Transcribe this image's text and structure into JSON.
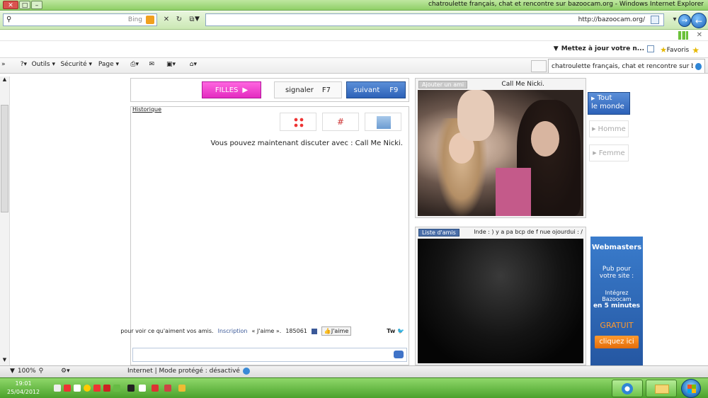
{
  "window": {
    "title": "chatroulette français, chat et rencontre sur bazoocam.org - Windows Internet Explorer",
    "close_label": "✕",
    "max_label": "□",
    "min_label": "–"
  },
  "address_bar": {
    "url": "http://bazoocam.org/",
    "search_placeholder": "Bing"
  },
  "favorites_bar": {
    "favoris_label": "Favoris",
    "update_label": "Mettez à jour votre n..."
  },
  "tab": {
    "label": "chatroulette français, chat et rencontre sur bazoo..."
  },
  "command_bar": {
    "page_label": "Page",
    "securite_label": "Sécurité",
    "outils_label": "Outils"
  },
  "chat": {
    "suivant_label": "suivant",
    "suivant_key": "F9",
    "signaler_label": "signaler",
    "signaler_key": "F7",
    "filles_label": "FILLES",
    "historique_label": "Historique",
    "message": "Vous pouvez maintenant discuter avec : Call Me Nicki.",
    "tweet_label": "Tw",
    "like_label": "J'aime",
    "like_count": "185061",
    "like_text_1": "« J'aime ».",
    "inscription_label": "Inscription",
    "like_text_2": "pour voir ce qu'aiment vos amis."
  },
  "video": {
    "partner_name": "Call Me Nicki.",
    "add_friend_label": "Ajouter un ami",
    "self_caption": "lnde : ) y a pa bcp de f nue ojourdui : /",
    "friend_list_label": "Liste d'amis"
  },
  "filters": {
    "all_label_1": "Tout",
    "all_label_2": "le monde",
    "homme_label": "Homme",
    "femme_label": "Femme"
  },
  "webmasters": {
    "title": "Webmasters",
    "line1": "Pub pour votre site :",
    "line2": "Intégrez Bazoocam",
    "line3": "en 5 minutes",
    "gratuit": "GRATUIT",
    "cta": "cliquez ici"
  },
  "status_bar": {
    "zone": "Internet | Mode protégé : désactivé",
    "zoom": "100%"
  },
  "taskbar": {
    "time": "19:01",
    "date": "25/04/2012"
  }
}
